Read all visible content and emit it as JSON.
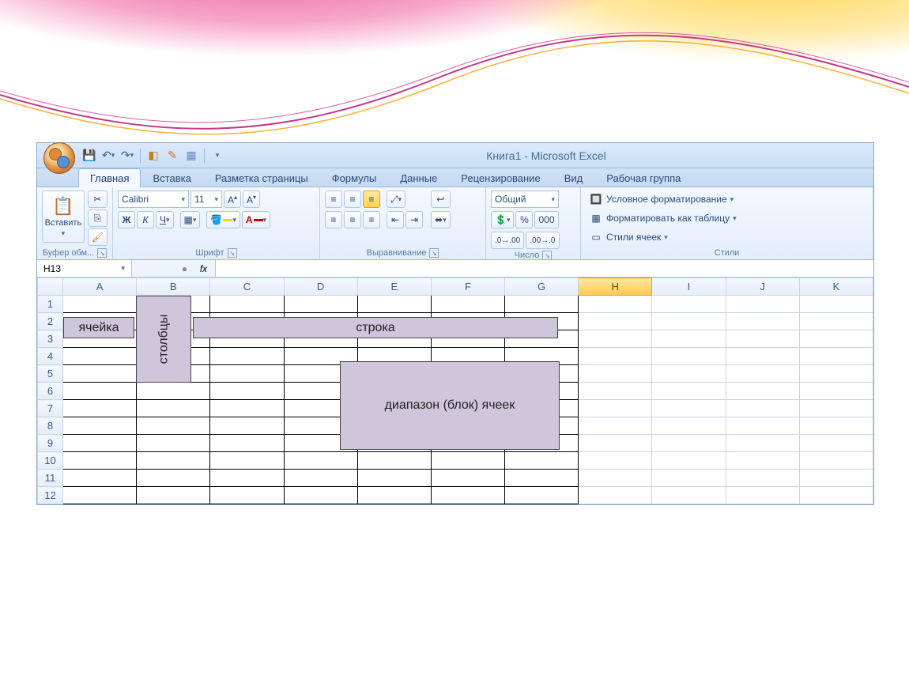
{
  "title": "Книга1 - Microsoft Excel",
  "qat": {
    "save": "save-icon",
    "undo": "undo-icon",
    "redo": "redo-icon"
  },
  "tabs": [
    {
      "label": "Главная",
      "active": true
    },
    {
      "label": "Вставка",
      "active": false
    },
    {
      "label": "Разметка страницы",
      "active": false
    },
    {
      "label": "Формулы",
      "active": false
    },
    {
      "label": "Данные",
      "active": false
    },
    {
      "label": "Рецензирование",
      "active": false
    },
    {
      "label": "Вид",
      "active": false
    },
    {
      "label": "Рабочая группа",
      "active": false
    }
  ],
  "ribbon": {
    "clipboard": {
      "paste_label": "Вставить",
      "group_label": "Буфер обм..."
    },
    "font": {
      "name": "Calibri",
      "size": "11",
      "bold": "Ж",
      "italic": "К",
      "underline": "Ч",
      "group_label": "Шрифт"
    },
    "alignment": {
      "group_label": "Выравнивание"
    },
    "number": {
      "format": "Общий",
      "group_label": "Число"
    },
    "styles": {
      "cond": "Условное форматирование",
      "table": "Форматировать как таблицу",
      "cell": "Стили ячеек",
      "group_label": "Стили"
    }
  },
  "namebox": "H13",
  "fx_symbol": "fx",
  "columns": [
    "A",
    "B",
    "C",
    "D",
    "E",
    "F",
    "G",
    "H",
    "I",
    "J",
    "K"
  ],
  "active_column": "H",
  "rows": [
    "1",
    "2",
    "3",
    "4",
    "5",
    "6",
    "7",
    "8",
    "9",
    "10",
    "11",
    "12"
  ],
  "overlays": {
    "cell": "ячейка",
    "columns": "столбцы",
    "row": "строка",
    "range": "диапазон (блок) ячеек"
  }
}
